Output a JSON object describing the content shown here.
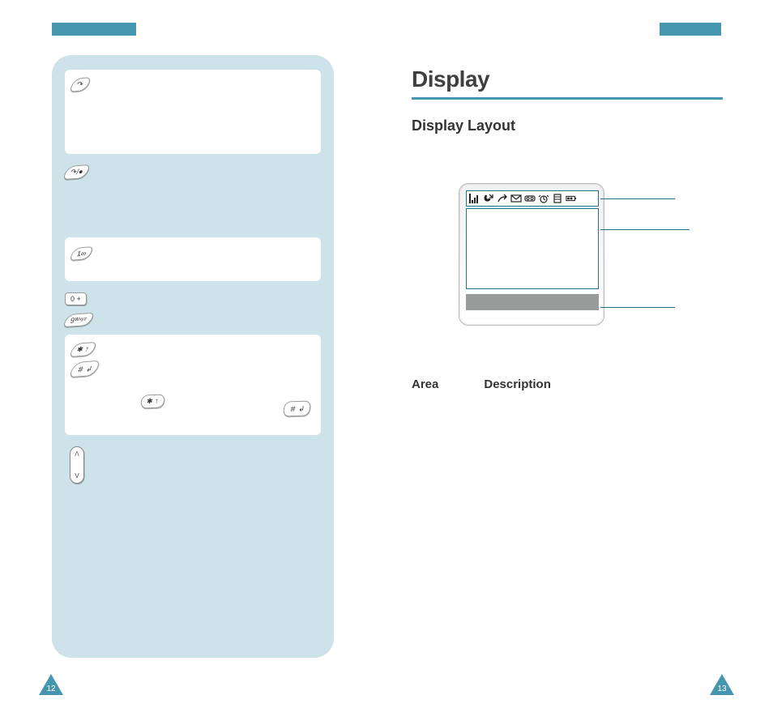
{
  "crop_color": "#4796b0",
  "left_panel": {
    "panel_bg": "#cde2e9",
    "keys": {
      "send": "↷",
      "end": "↷/●",
      "one": "1∞",
      "zero": "0 +",
      "nine": "9ᵂˣʸᶻ",
      "star": "✱ ↑",
      "hash": "＃ ↲",
      "star2": "✱ ↑",
      "hash2": "＃ ↲",
      "vol_up": "ᐱ",
      "vol_down": "ᐯ"
    }
  },
  "right": {
    "title": "Display",
    "subtitle": "Display Layout",
    "icon_bar": {
      "signal": "▮◢",
      "call": "↗",
      "divert": "⤴",
      "msg": "✉",
      "voice": "◙◙",
      "alarm": "⏰",
      "sim": "▤",
      "battery": "▮▯"
    },
    "table": {
      "col1": "Area",
      "col2": "Description"
    }
  },
  "pages": {
    "left": "12",
    "right": "13"
  }
}
